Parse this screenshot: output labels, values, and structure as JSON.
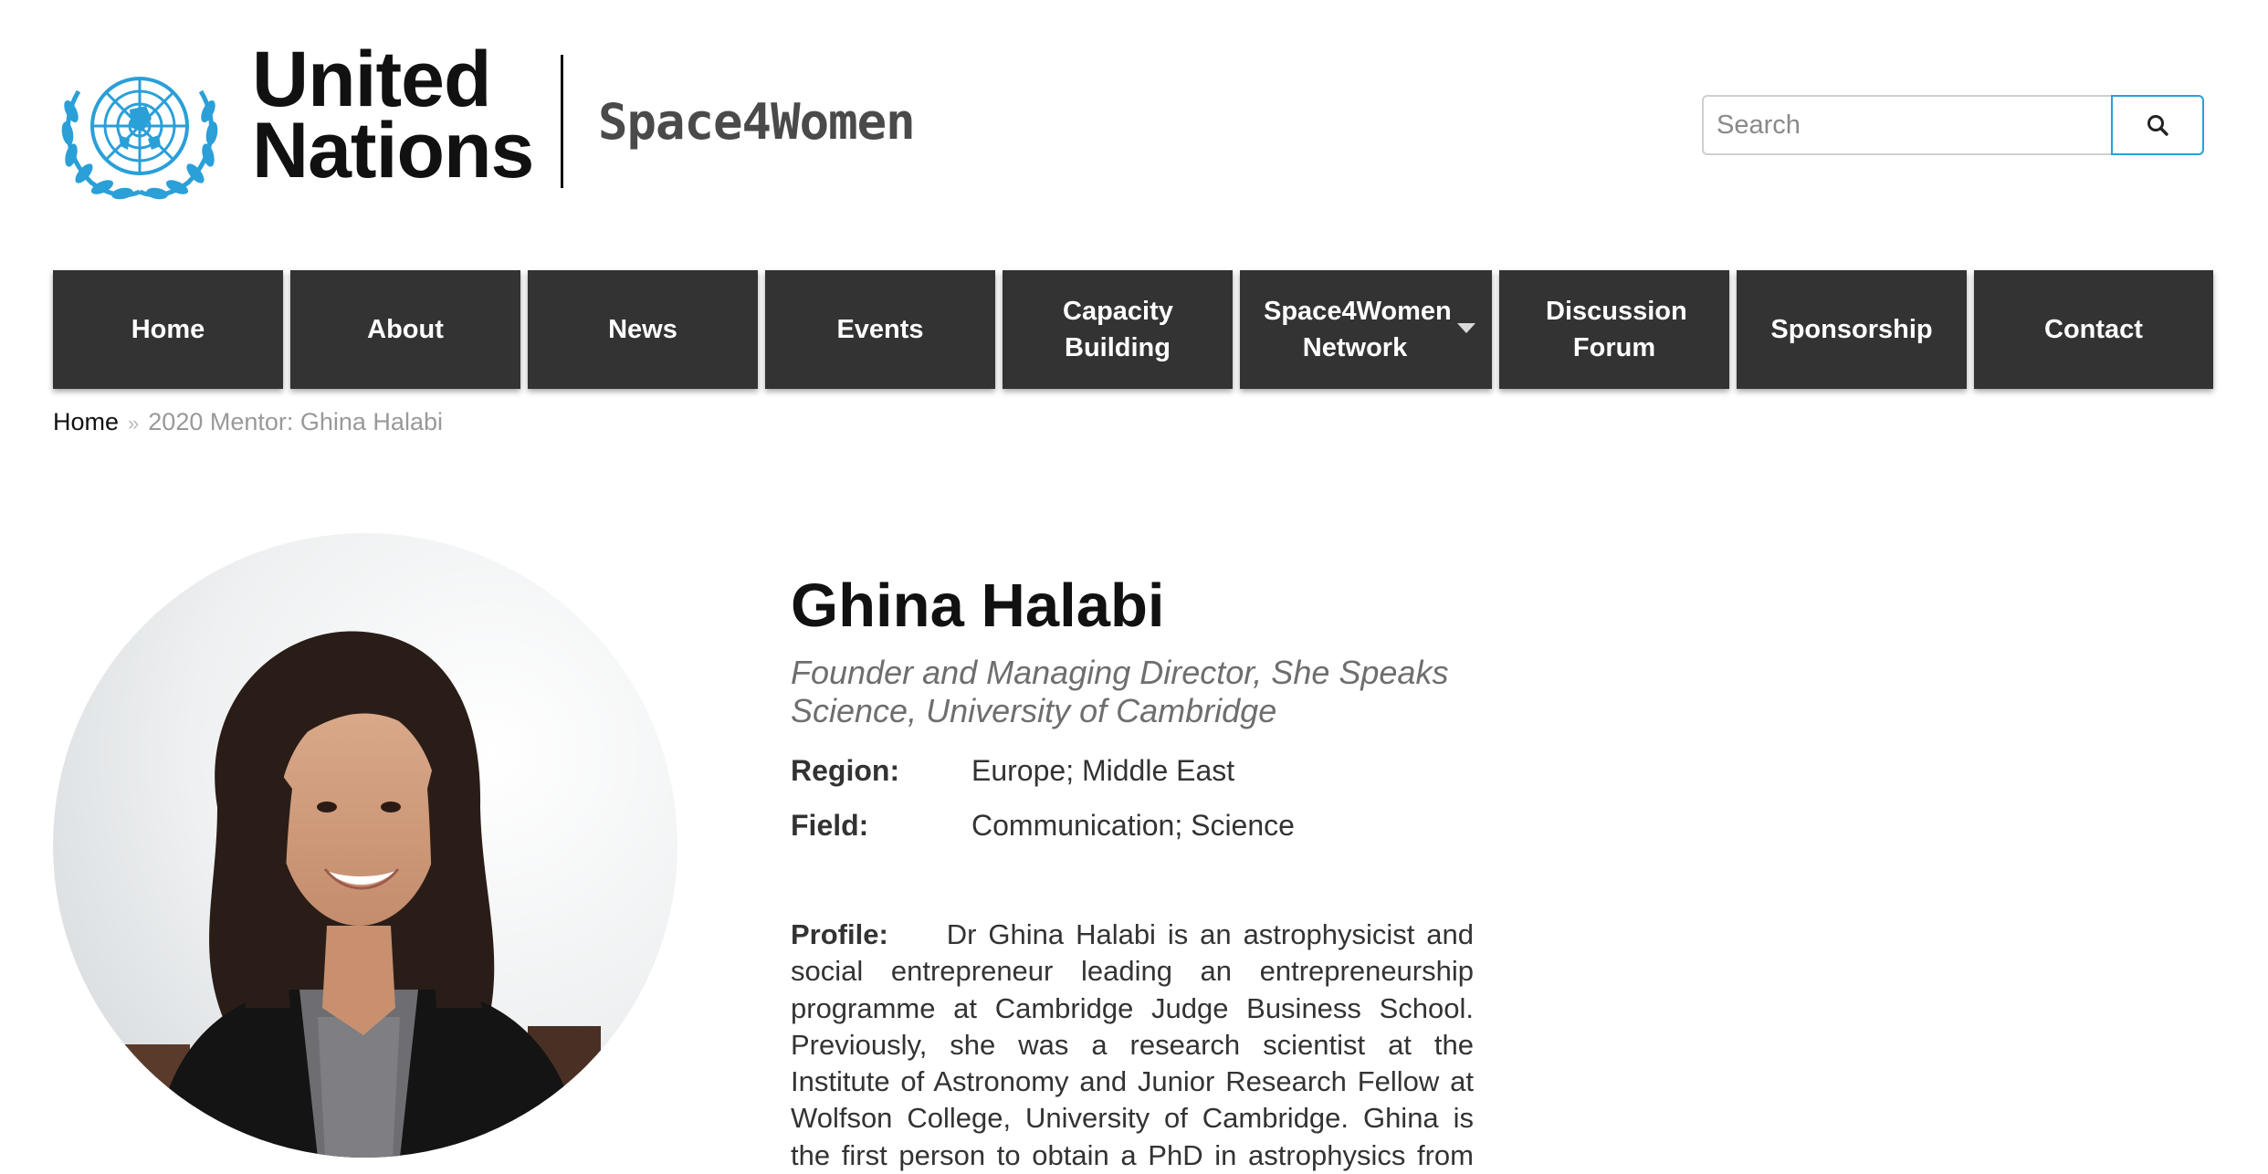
{
  "header": {
    "org_line1": "United",
    "org_line2": "Nations",
    "site_name": "Space4Women",
    "search": {
      "placeholder": "Search"
    },
    "accent_color": "#2a9fd8"
  },
  "nav": {
    "items": [
      {
        "label": "Home"
      },
      {
        "label": "About"
      },
      {
        "label": "News"
      },
      {
        "label": "Events"
      },
      {
        "label": "Capacity Building"
      },
      {
        "label": "Space4Women Network",
        "has_dropdown": true
      },
      {
        "label": "Discussion Forum"
      },
      {
        "label": "Sponsorship"
      },
      {
        "label": "Contact"
      }
    ],
    "background_color": "#333333"
  },
  "breadcrumb": {
    "home": "Home",
    "separator": "»",
    "current": "2020 Mentor: Ghina Halabi"
  },
  "mentor": {
    "name": "Ghina Halabi",
    "role": "Founder and Managing Director, She Speaks Science, University of Cambridge",
    "region_label": "Region:",
    "region_value": "Europe; Middle East",
    "field_label": "Field:",
    "field_value": "Communication; Science",
    "profile_label": "Profile:",
    "profile_text": "Dr Ghina Halabi is an astrophysicist and social entrepreneur leading an entrepreneurship programme at Cambridge Judge Business School. Previously, she was a research scientist at the Institute of Astronomy and Junior Research Fellow at Wolfson College, University of Cambridge. Ghina is the first person to obtain a PhD in astrophysics from Lebanon and is the founder of She Speaks Science."
  }
}
